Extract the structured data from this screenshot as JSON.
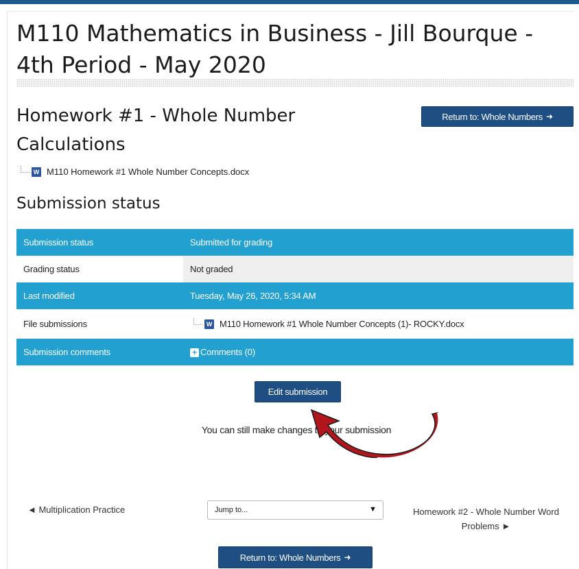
{
  "course": {
    "title": "M110 Mathematics in Business - Jill Bourque - 4th Period - May 2020"
  },
  "assignment": {
    "title": "Homework #1 - Whole Number Calculations",
    "attachment": "M110 Homework #1 Whole Number Concepts.docx",
    "return_label": "Return to: Whole Numbers"
  },
  "icons": {
    "file": "word-doc-icon",
    "plus": "plus-icon",
    "arrow": "arrow-right-icon"
  },
  "colors": {
    "accent": "#22a0cf",
    "button": "#1f4f82",
    "annotation_arrow": "#b0161b"
  },
  "status": {
    "heading": "Submission status",
    "rows": [
      {
        "label": "Submission status",
        "value": "Submitted for grading"
      },
      {
        "label": "Grading status",
        "value": "Not graded"
      },
      {
        "label": "Last modified",
        "value": "Tuesday, May 26, 2020, 5:34 AM"
      },
      {
        "label": "File submissions",
        "value": "M110 Homework #1 Whole Number Concepts (1)- ROCKY.docx"
      },
      {
        "label": "Submission comments",
        "value": "Comments (0)"
      }
    ]
  },
  "actions": {
    "edit_label": "Edit submission",
    "note": "You can still make changes to your submission"
  },
  "nav": {
    "prev": "◄ Multiplication Practice",
    "jump_placeholder": "Jump to...",
    "next": "Homework #2 - Whole Number Word Problems ►",
    "return_label": "Return to: Whole Numbers"
  }
}
